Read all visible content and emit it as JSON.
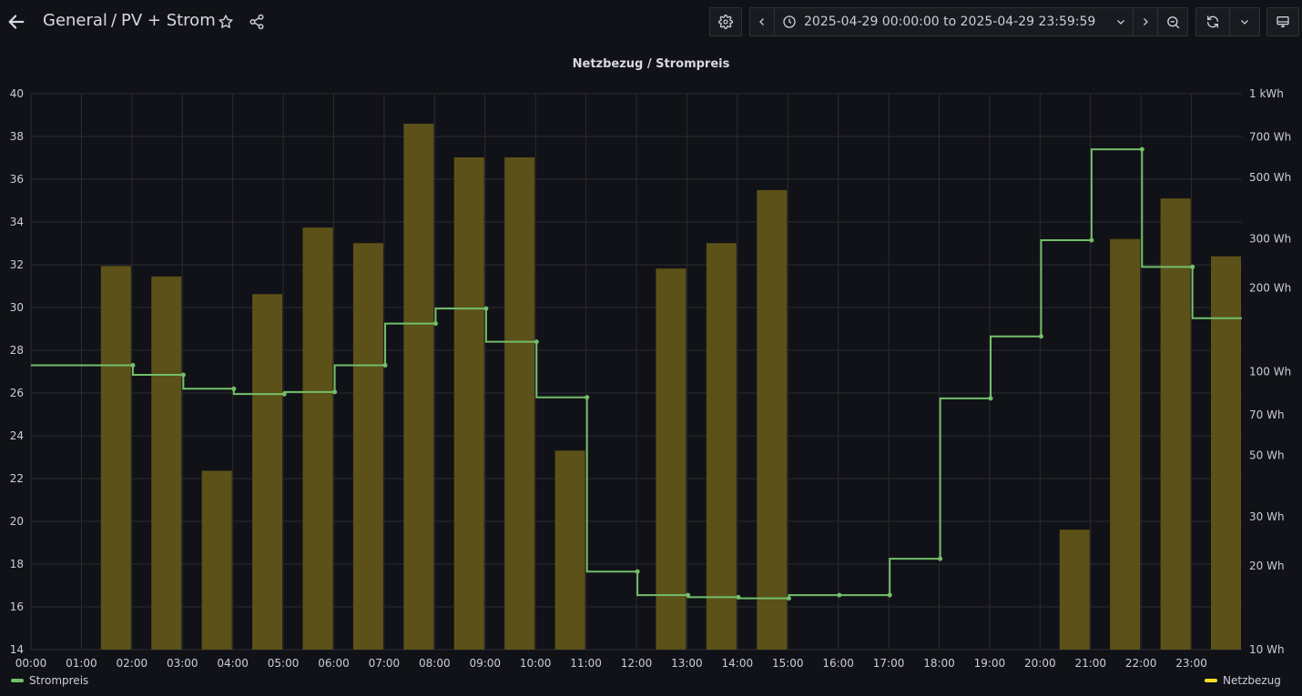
{
  "header": {
    "breadcrumb_root": "General",
    "breadcrumb_separator": "/",
    "breadcrumb_page": "PV + Strom",
    "time_range": "2025-04-29 00:00:00 to 2025-04-29 23:59:59"
  },
  "icons": {
    "back": "arrow-left-icon",
    "star": "star-icon",
    "share": "share-icon",
    "settings": "gear-icon",
    "prev": "chevron-left-icon",
    "clock": "clock-icon",
    "dropdown": "chevron-down-icon",
    "next": "chevron-right-icon",
    "zoom_out": "zoom-out-icon",
    "refresh": "refresh-icon",
    "tv": "tv-mode-icon"
  },
  "panel": {
    "title": "Netzbezug / Strompreis"
  },
  "colors": {
    "background": "#111217",
    "grid": "#2a2c32",
    "price_line": "#73bf69",
    "bar_fill": "#5c5118",
    "legend_netzbezug": "#fade2a"
  },
  "chart_data": {
    "type": "bar+line",
    "x_ticks": [
      "00:00",
      "01:00",
      "02:00",
      "03:00",
      "04:00",
      "05:00",
      "06:00",
      "07:00",
      "08:00",
      "09:00",
      "10:00",
      "11:00",
      "12:00",
      "13:00",
      "14:00",
      "15:00",
      "16:00",
      "17:00",
      "18:00",
      "19:00",
      "20:00",
      "21:00",
      "22:00",
      "23:00"
    ],
    "y_left": {
      "min": 14,
      "max": 40,
      "ticks": [
        "14",
        "16",
        "18",
        "20",
        "22",
        "24",
        "26",
        "28",
        "30",
        "32",
        "34",
        "36",
        "38",
        "40"
      ]
    },
    "y_right": {
      "scale": "log",
      "min_wh": 10,
      "max_wh": 1000,
      "ticks": [
        {
          "value": 10,
          "label": "10 Wh"
        },
        {
          "value": 20,
          "label": "20 Wh"
        },
        {
          "value": 30,
          "label": "30 Wh"
        },
        {
          "value": 50,
          "label": "50 Wh"
        },
        {
          "value": 70,
          "label": "70 Wh"
        },
        {
          "value": 100,
          "label": "100 Wh"
        },
        {
          "value": 200,
          "label": "200 Wh"
        },
        {
          "value": 300,
          "label": "300 Wh"
        },
        {
          "value": 500,
          "label": "500 Wh"
        },
        {
          "value": 700,
          "label": "700 Wh"
        },
        {
          "value": 1000,
          "label": "1 kWh"
        }
      ]
    },
    "series": [
      {
        "name": "Strompreis",
        "axis": "left",
        "style": "step-line",
        "x": [
          "00:00",
          "01:00",
          "02:00",
          "03:00",
          "04:00",
          "05:00",
          "06:00",
          "07:00",
          "08:00",
          "09:00",
          "10:00",
          "11:00",
          "12:00",
          "13:00",
          "14:00",
          "15:00",
          "16:00",
          "17:00",
          "18:00",
          "19:00",
          "20:00",
          "21:00",
          "22:00",
          "23:00"
        ],
        "values": [
          27.3,
          27.3,
          26.85,
          26.2,
          25.95,
          26.05,
          27.3,
          29.25,
          29.95,
          28.4,
          25.8,
          17.65,
          16.55,
          16.45,
          16.4,
          16.55,
          16.55,
          18.25,
          25.75,
          28.65,
          33.15,
          37.4,
          31.9,
          29.5
        ]
      },
      {
        "name": "Netzbezug",
        "axis": "right",
        "style": "bar",
        "unit": "Wh",
        "x": [
          "00:00",
          "01:00",
          "02:00",
          "03:00",
          "04:00",
          "05:00",
          "06:00",
          "07:00",
          "08:00",
          "09:00",
          "10:00",
          "11:00",
          "12:00",
          "13:00",
          "14:00",
          "15:00",
          "16:00",
          "17:00",
          "18:00",
          "19:00",
          "20:00",
          "21:00",
          "22:00",
          "23:00"
        ],
        "values": [
          null,
          240,
          220,
          44,
          190,
          330,
          290,
          780,
          590,
          590,
          52,
          null,
          235,
          290,
          450,
          null,
          null,
          null,
          null,
          null,
          27,
          300,
          420,
          260
        ]
      }
    ]
  },
  "legend": {
    "left": "Strompreis",
    "right": "Netzbezug"
  }
}
